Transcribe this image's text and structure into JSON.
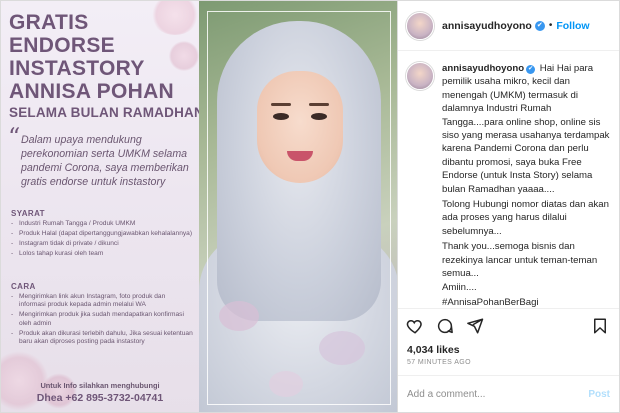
{
  "poster": {
    "title": "GRATIS ENDORSE INSTASTORY ANNISA POHAN",
    "subtitle": "SELAMA BULAN RAMADHAN",
    "quote_mark": "“",
    "quote": "Dalam upaya mendukung perekonomian serta UMKM selama pandemi Corona, saya memberikan gratis endorse untuk instastory",
    "syarat_heading": "SYARAT",
    "syarat_items": [
      "Industri Rumah Tangga / Produk UMKM",
      "Produk Halal (dapat dipertanggungjawabkan kehalalannya)",
      "Instagram tidak di private / dikunci",
      "Lolos tahap kurasi oleh team"
    ],
    "cara_heading": "CARA",
    "cara_items": [
      "Mengirimkan link akun Instagram, foto produk dan informasi produk kepada admin melalui WA",
      "Mengirimkan produk jika sudah mendapatkan konfirmasi oleh admin",
      "Produk akan dikurasi terlebih dahulu, Jika sesuai ketentuan baru akan diproses posting pada instastory"
    ],
    "contact_label": "Untuk Info silahkan menghubungi",
    "contact": "Dhea +62 895-3732-04741"
  },
  "header": {
    "username": "annisayudhoyono",
    "verified_icon": "✔",
    "separator": "•",
    "follow_label": "Follow"
  },
  "caption": {
    "username": "annisayudhoyono",
    "verified_icon": "✔",
    "paragraphs": [
      "Hai Hai para pemilik usaha mikro, kecil dan menengah (UMKM) termasuk di dalamnya Industri Rumah Tangga....para online shop, online sis siso yang merasa usahanya terdampak karena Pandemi Corona dan perlu dibantu promosi, saya buka Free Endorse (untuk Insta Story) selama bulan Ramadhan yaaaa....",
      "Tolong Hubungi nomor diatas dan akan ada proses yang harus dilalui sebelumnya...",
      "Thank you...semoga bisnis dan rezekinya lancar untuk teman-teman semua...",
      "Amiin....",
      "#AnnisaPohanBerBagi"
    ]
  },
  "actions": {
    "like_icon": "heart-icon",
    "comment_icon": "comment-icon",
    "share_icon": "share-icon",
    "save_icon": "bookmark-icon"
  },
  "likes": "4,034 likes",
  "timeago": "57 MINUTES AGO",
  "comment_box": {
    "placeholder": "Add a comment...",
    "post_label": "Post"
  }
}
